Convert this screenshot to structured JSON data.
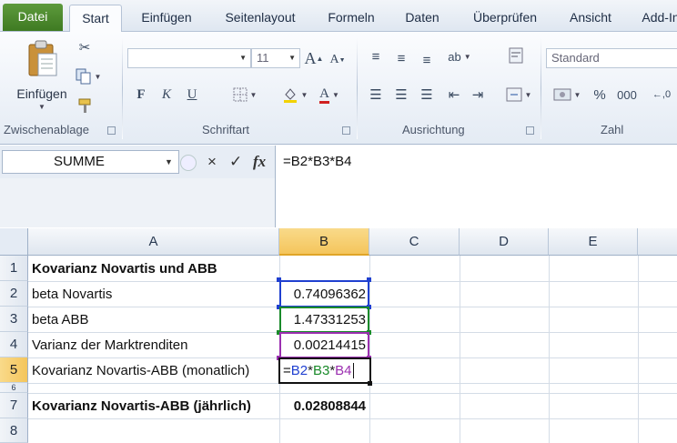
{
  "tabs": [
    {
      "label": "Datei",
      "kind": "file"
    },
    {
      "label": "Start",
      "kind": "active"
    },
    {
      "label": "Einfügen",
      "kind": ""
    },
    {
      "label": "Seitenlayout",
      "kind": ""
    },
    {
      "label": "Formeln",
      "kind": ""
    },
    {
      "label": "Daten",
      "kind": ""
    },
    {
      "label": "Überprüfen",
      "kind": ""
    },
    {
      "label": "Ansicht",
      "kind": ""
    },
    {
      "label": "Add-In",
      "kind": ""
    }
  ],
  "ribbon": {
    "paste_label": "Einfügen",
    "font_size": "11",
    "number_format": "Standard",
    "bold": "F",
    "italic": "K",
    "underline": "U",
    "grow_font": "A",
    "shrink_font": "A",
    "font_color": "A",
    "percent": "%",
    "thousands": "000",
    "groups": {
      "clipboard": "Zwischenablage",
      "font": "Schriftart",
      "alignment": "Ausrichtung",
      "number": "Zahl"
    }
  },
  "formula_bar": {
    "name_box": "SUMME",
    "cancel_icon": "×",
    "confirm_icon": "✓",
    "fx": "fx",
    "formula": "=B2*B3*B4"
  },
  "columns": [
    "A",
    "B",
    "C",
    "D",
    "E"
  ],
  "rows": [
    "1",
    "2",
    "3",
    "4",
    "5",
    "6",
    "7",
    "8"
  ],
  "cells": {
    "A1": "Kovarianz Novartis und ABB",
    "A2": "beta Novartis",
    "B2": "0.74096362",
    "A3": "beta ABB",
    "B3": "1.47331253",
    "A4": "Varianz der Marktrenditen",
    "B4": "0.00214415",
    "A5": "Kovarianz Novartis-ABB (monatlich)",
    "A7": "Kovarianz Novartis-ABB (jährlich)",
    "B7": "0.02808844"
  },
  "editing": {
    "eq": "=",
    "r1": "B2",
    "op1": "*",
    "r2": "B3",
    "op2": "*",
    "r3": "B4"
  },
  "colors": {
    "ref1": "#2040d0",
    "ref2": "#1a8a2a",
    "ref3": "#9b2fb0",
    "selected_header": "#f4c55c",
    "file_tab": "#4a8a2c"
  }
}
